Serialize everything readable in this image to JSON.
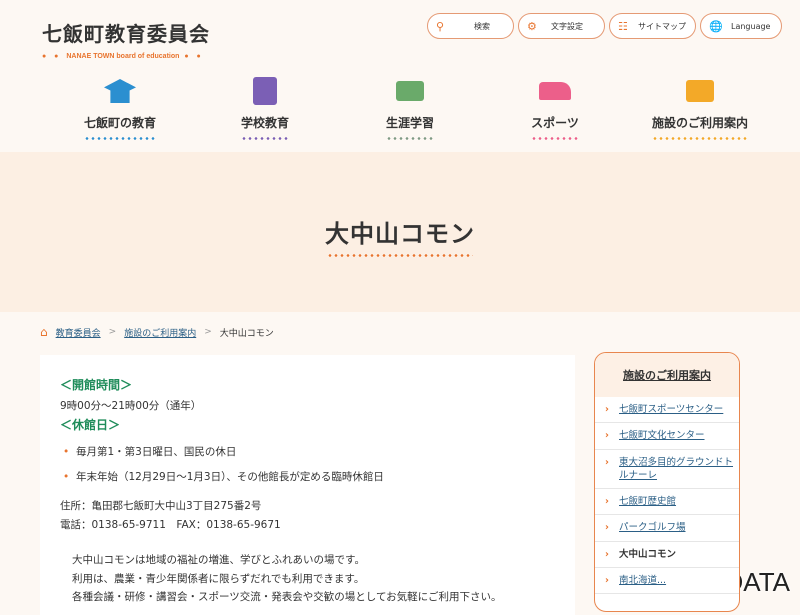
{
  "logo": {
    "title": "七飯町教育委員会",
    "subtitle": "NANAE TOWN board of education"
  },
  "tools": [
    {
      "label": "検索",
      "icon": "search-icon"
    },
    {
      "label": "文字設定",
      "icon": "gear-icon"
    },
    {
      "label": "サイトマップ",
      "icon": "sitemap-icon"
    },
    {
      "label": "Language",
      "icon": "globe-icon"
    }
  ],
  "nav": [
    {
      "label": "七飯町の教育",
      "color": "#2b8fd0"
    },
    {
      "label": "学校教育",
      "color": "#7b5fb5"
    },
    {
      "label": "生涯学習",
      "color": "#6aaa6a"
    },
    {
      "label": "スポーツ",
      "color": "#ec5f8a"
    },
    {
      "label": "施設のご利用案内",
      "color": "#f3a928"
    }
  ],
  "page_title": "大中山コモン",
  "breadcrumb": [
    "教育委員会",
    "施設のご利用案内",
    "大中山コモン"
  ],
  "main": {
    "hours_heading": "＜開館時間＞",
    "hours": "9時00分～21時00分（通年）",
    "closed_heading": "＜休館日＞",
    "closed": [
      "毎月第1・第3日曜日、国民の休日",
      "年末年始（12月29日～1月3日）、その他館長が定める臨時休館日"
    ],
    "address": "住所：亀田郡七飯町大中山3丁目275番2号",
    "phone": "電話：0138-65-9711　FAX：0138-65-9671",
    "desc": [
      "大中山コモンは地域の福祉の増進、学びとふれあいの場です。",
      "利用は、農業・青少年関係者に限らずだれでも利用できます。",
      "各種会議・研修・講習会・スポーツ交流・発表会や交歓の場としてお気軽にご利用下さい。"
    ]
  },
  "sidebar": {
    "heading": "施設のご利用案内",
    "items": [
      "七飯町スポーツセンター",
      "七飯町文化センター",
      "東大沼多目的グラウンドトルナーレ",
      "七飯町歴史館",
      "パークゴルフ場",
      "大中山コモン",
      "南北海道..."
    ]
  },
  "watermark": "©MDATA"
}
